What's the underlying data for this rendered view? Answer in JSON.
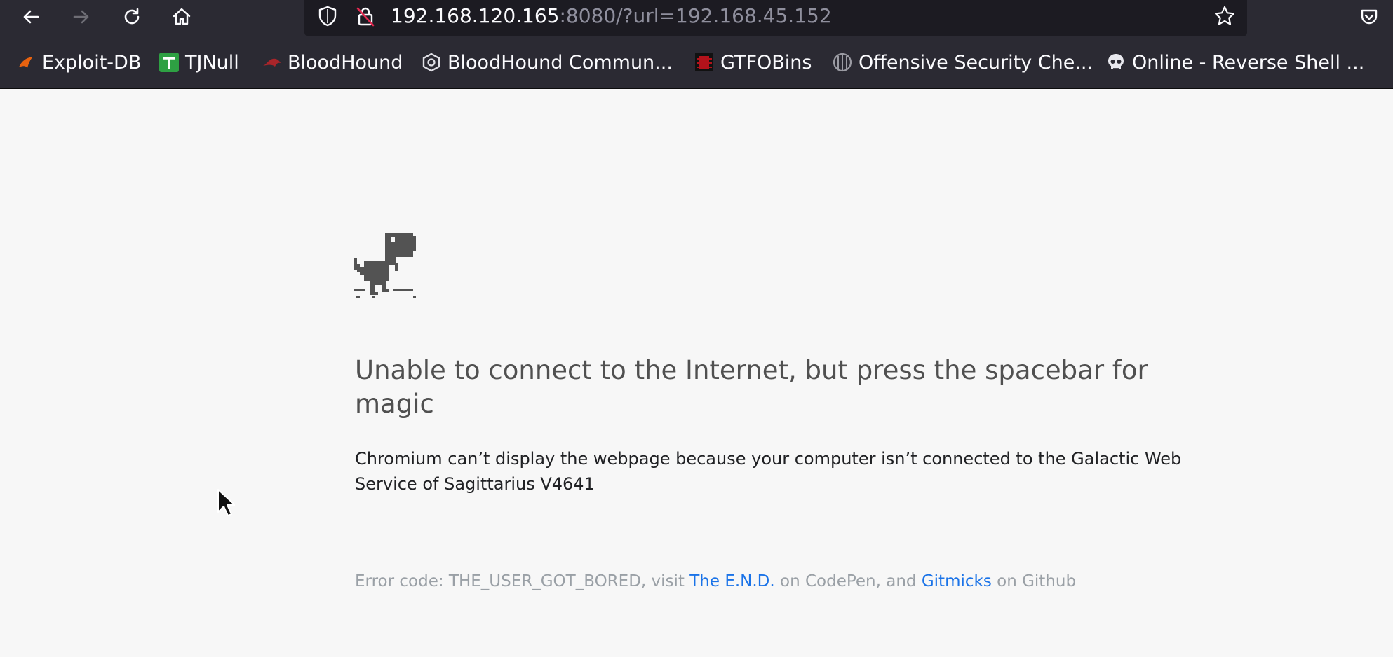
{
  "browser": {
    "url_host": "192.168.120.165",
    "url_rest": ":8080/?url=192.168.45.152"
  },
  "bookmarks": [
    {
      "label": "Exploit-DB",
      "icon": "exploit-db-icon"
    },
    {
      "label": "TJNull",
      "icon": "tjnull-icon"
    },
    {
      "label": "BloodHound",
      "icon": "bloodhound-icon"
    },
    {
      "label": "BloodHound Commun...",
      "icon": "bloodhound-community-icon"
    },
    {
      "label": "GTFOBins",
      "icon": "gtfobins-icon"
    },
    {
      "label": "Offensive Security Che...",
      "icon": "offsec-icon"
    },
    {
      "label": "Online - Reverse Shell ...",
      "icon": "skull-icon"
    }
  ],
  "page": {
    "heading": "Unable to connect to the Internet, but press the spacebar for magic",
    "description": "Chromium can’t display the webpage because your computer isn’t connected to the Galactic Web Service of Sagittarius V4641",
    "error_prefix": "Error code: THE_USER_GOT_BORED, visit ",
    "link1": "The E.N.D.",
    "error_mid": " on CodePen, and ",
    "link2": "Gitmicks",
    "error_suffix": " on Github"
  },
  "colors": {
    "chrome_bg": "#2b2a33",
    "urlbar_bg": "#1c1b22",
    "page_bg": "#f7f7f7",
    "link": "#1a73e8"
  }
}
